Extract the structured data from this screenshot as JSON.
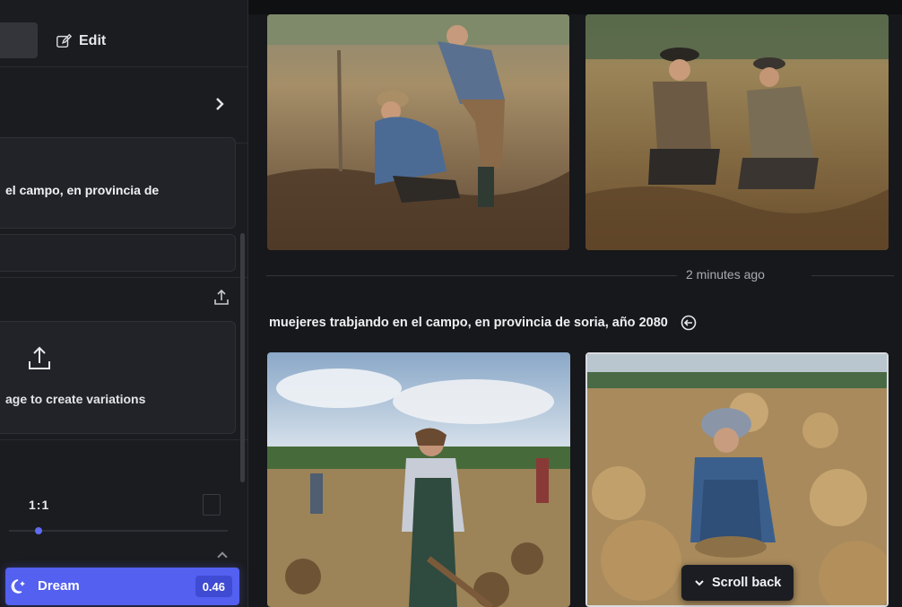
{
  "sidebar": {
    "edit_label": "Edit",
    "prompt_text": "el campo, en provincia de",
    "upload_text": "age to create variations",
    "aspect_ratio": "1:1",
    "dream_label": "Dream",
    "dream_cost": "0.46"
  },
  "feed": {
    "timestamp": "2 minutes ago",
    "prompt": "muejeres trabjando en el campo, en provincia de soria, año 2080",
    "scroll_back_label": "Scroll back"
  },
  "colors": {
    "accent": "#5360f0",
    "background": "#141518"
  }
}
